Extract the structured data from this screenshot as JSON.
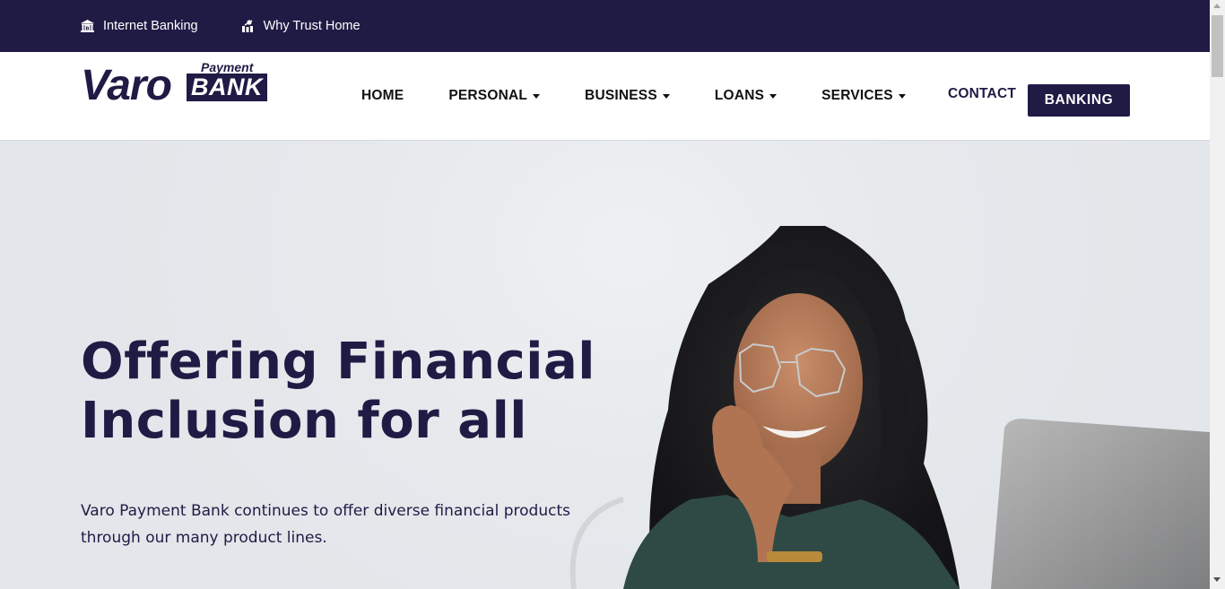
{
  "topbar": {
    "links": [
      {
        "label": "Internet Banking",
        "icon": "bank-building-icon"
      },
      {
        "label": "Why Trust Home",
        "icon": "trust-chart-icon"
      }
    ]
  },
  "header": {
    "logo": {
      "wordmark": "Varo",
      "sub_top": "Payment",
      "sub_box": "BANK"
    },
    "nav": [
      {
        "label": "HOME",
        "dropdown": false
      },
      {
        "label": "PERSONAL",
        "dropdown": true
      },
      {
        "label": "BUSINESS",
        "dropdown": true
      },
      {
        "label": "LOANS",
        "dropdown": true
      },
      {
        "label": "SERVICES",
        "dropdown": true
      }
    ],
    "contact_label": "CONTACT",
    "banking_button_label": "BANKING"
  },
  "hero": {
    "title_line1": "Offering Financial",
    "title_line2": "Inclusion for all",
    "description": "Varo Payment Bank continues to offer diverse financial products through our many product lines.",
    "image_alt": "Smiling woman with curly hair and glasses resting chin on hand beside a laptop"
  },
  "colors": {
    "brand_navy": "#201b45",
    "hero_bg": "#e5e8eb",
    "header_border": "#d6d8db"
  }
}
